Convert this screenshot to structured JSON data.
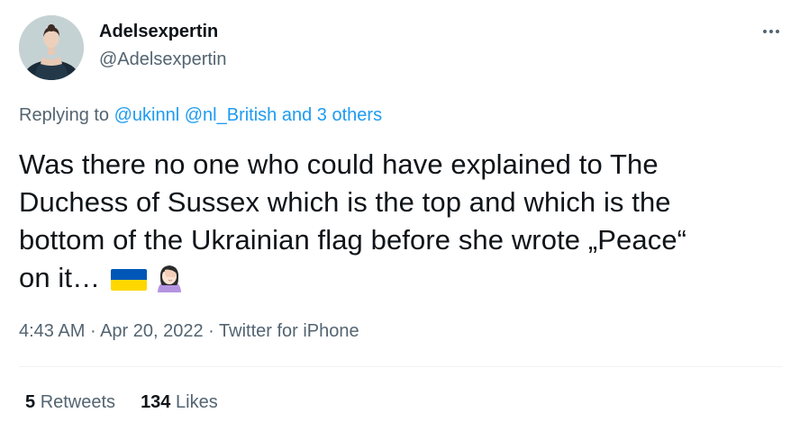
{
  "author": {
    "display_name": "Adelsexpertin",
    "handle": "@Adelsexpertin",
    "avatar_icon": "avatar-woman-dark-dress"
  },
  "more_icon": "more-horizontal-icon",
  "replying": {
    "prefix": "Replying to",
    "mention_1": "@ukinnl",
    "mention_2": "@nl_British",
    "others": "and 3 others"
  },
  "tweet": {
    "line_1": "Was there no one who could have explained to The",
    "line_2": "Duchess of Sussex which is the top and which is the",
    "line_3": "bottom of the Ukrainian flag before she wrote „Peace“",
    "line_4": "on it…",
    "emojis": [
      "ukraine-flag-icon",
      "woman-facepalming-icon"
    ]
  },
  "meta": {
    "time": "4:43 AM",
    "separator_1": " · ",
    "date": "Apr 20, 2022",
    "separator_2": " · ",
    "source": "Twitter for iPhone"
  },
  "stats": {
    "retweets_count": "5",
    "retweets_label": "Retweets",
    "likes_count": "134",
    "likes_label": "Likes"
  },
  "colors": {
    "text": "#0f1419",
    "secondary": "#536471",
    "link": "#1d9bf0",
    "divider": "#eff3f4",
    "flag_blue": "#0057b7",
    "flag_yellow": "#ffd700"
  }
}
